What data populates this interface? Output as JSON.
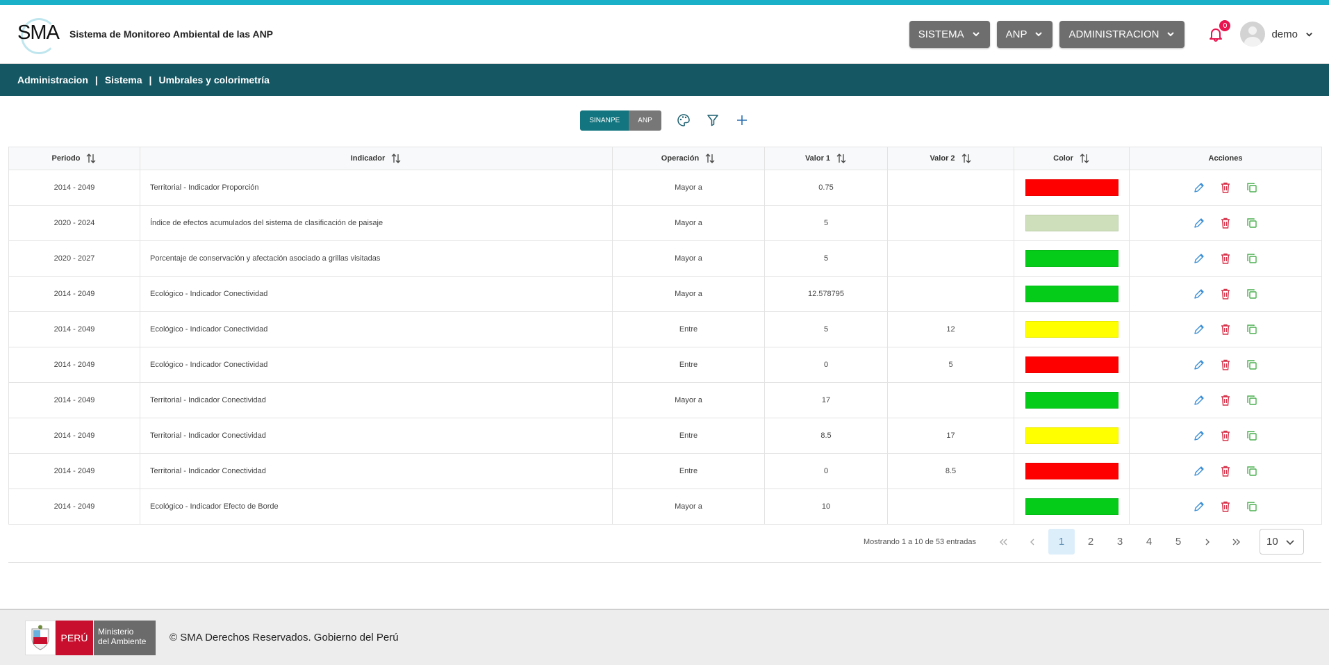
{
  "header": {
    "logo_text": "SMA",
    "app_title": "Sistema de Monitoreo Ambiental de las ANP",
    "menus": [
      "SISTEMA",
      "ANP",
      "ADMINISTRACION"
    ],
    "notification_count": "0",
    "user_name": "demo"
  },
  "breadcrumb": {
    "items": [
      "Administracion",
      "Sistema",
      "Umbrales y colorimetría"
    ],
    "separator": "|"
  },
  "toolbar": {
    "segment_active": "SINANPE",
    "segment_inactive": "ANP",
    "icons": [
      "palette-icon",
      "filter-icon",
      "add-icon"
    ]
  },
  "table": {
    "columns": [
      "Periodo",
      "Indicador",
      "Operación",
      "Valor 1",
      "Valor 2",
      "Color",
      "Acciones"
    ],
    "rows": [
      {
        "periodo": "2014 - 2049",
        "indicador": "Territorial - Indicador Proporción",
        "operacion": "Mayor a",
        "valor1": "0.75",
        "valor2": "",
        "color": "#ff0000"
      },
      {
        "periodo": "2020 - 2024",
        "indicador": "Índice de efectos acumulados del sistema de clasificación de paisaje",
        "operacion": "Mayor a",
        "valor1": "5",
        "valor2": "",
        "color": "#cedfbb"
      },
      {
        "periodo": "2020 - 2027",
        "indicador": "Porcentaje de conservación y afectación asociado a grillas visitadas",
        "operacion": "Mayor a",
        "valor1": "5",
        "valor2": "",
        "color": "#05cc18"
      },
      {
        "periodo": "2014 - 2049",
        "indicador": "Ecológico - Indicador Conectividad",
        "operacion": "Mayor a",
        "valor1": "12.578795",
        "valor2": "",
        "color": "#05cc18"
      },
      {
        "periodo": "2014 - 2049",
        "indicador": "Ecológico - Indicador Conectividad",
        "operacion": "Entre",
        "valor1": "5",
        "valor2": "12",
        "color": "#ffff00"
      },
      {
        "periodo": "2014 - 2049",
        "indicador": "Ecológico - Indicador Conectividad",
        "operacion": "Entre",
        "valor1": "0",
        "valor2": "5",
        "color": "#ff0000"
      },
      {
        "periodo": "2014 - 2049",
        "indicador": "Territorial - Indicador Conectividad",
        "operacion": "Mayor a",
        "valor1": "17",
        "valor2": "",
        "color": "#05cc18"
      },
      {
        "periodo": "2014 - 2049",
        "indicador": "Territorial - Indicador Conectividad",
        "operacion": "Entre",
        "valor1": "8.5",
        "valor2": "17",
        "color": "#ffff00"
      },
      {
        "periodo": "2014 - 2049",
        "indicador": "Territorial - Indicador Conectividad",
        "operacion": "Entre",
        "valor1": "0",
        "valor2": "8.5",
        "color": "#ff0000"
      },
      {
        "periodo": "2014 - 2049",
        "indicador": "Ecológico - Indicador Efecto de Borde",
        "operacion": "Mayor a",
        "valor1": "10",
        "valor2": "",
        "color": "#05cc18"
      }
    ]
  },
  "pagination": {
    "info": "Mostrando 1 a 10 de 53 entradas",
    "pages": [
      "1",
      "2",
      "3",
      "4",
      "5"
    ],
    "current_page": "1",
    "per_page": "10"
  },
  "footer": {
    "peru_label": "PERÚ",
    "ministry_line1": "Ministerio",
    "ministry_line2": "del Ambiente",
    "copyright": "© SMA Derechos Reservados. Gobierno del Perú"
  },
  "colors": {
    "accent_teal": "#155763",
    "top_line": "#1ab0c8",
    "edit_icon": "#3a8fd6",
    "delete_icon": "#d6344b",
    "copy_icon": "#4caf50"
  }
}
